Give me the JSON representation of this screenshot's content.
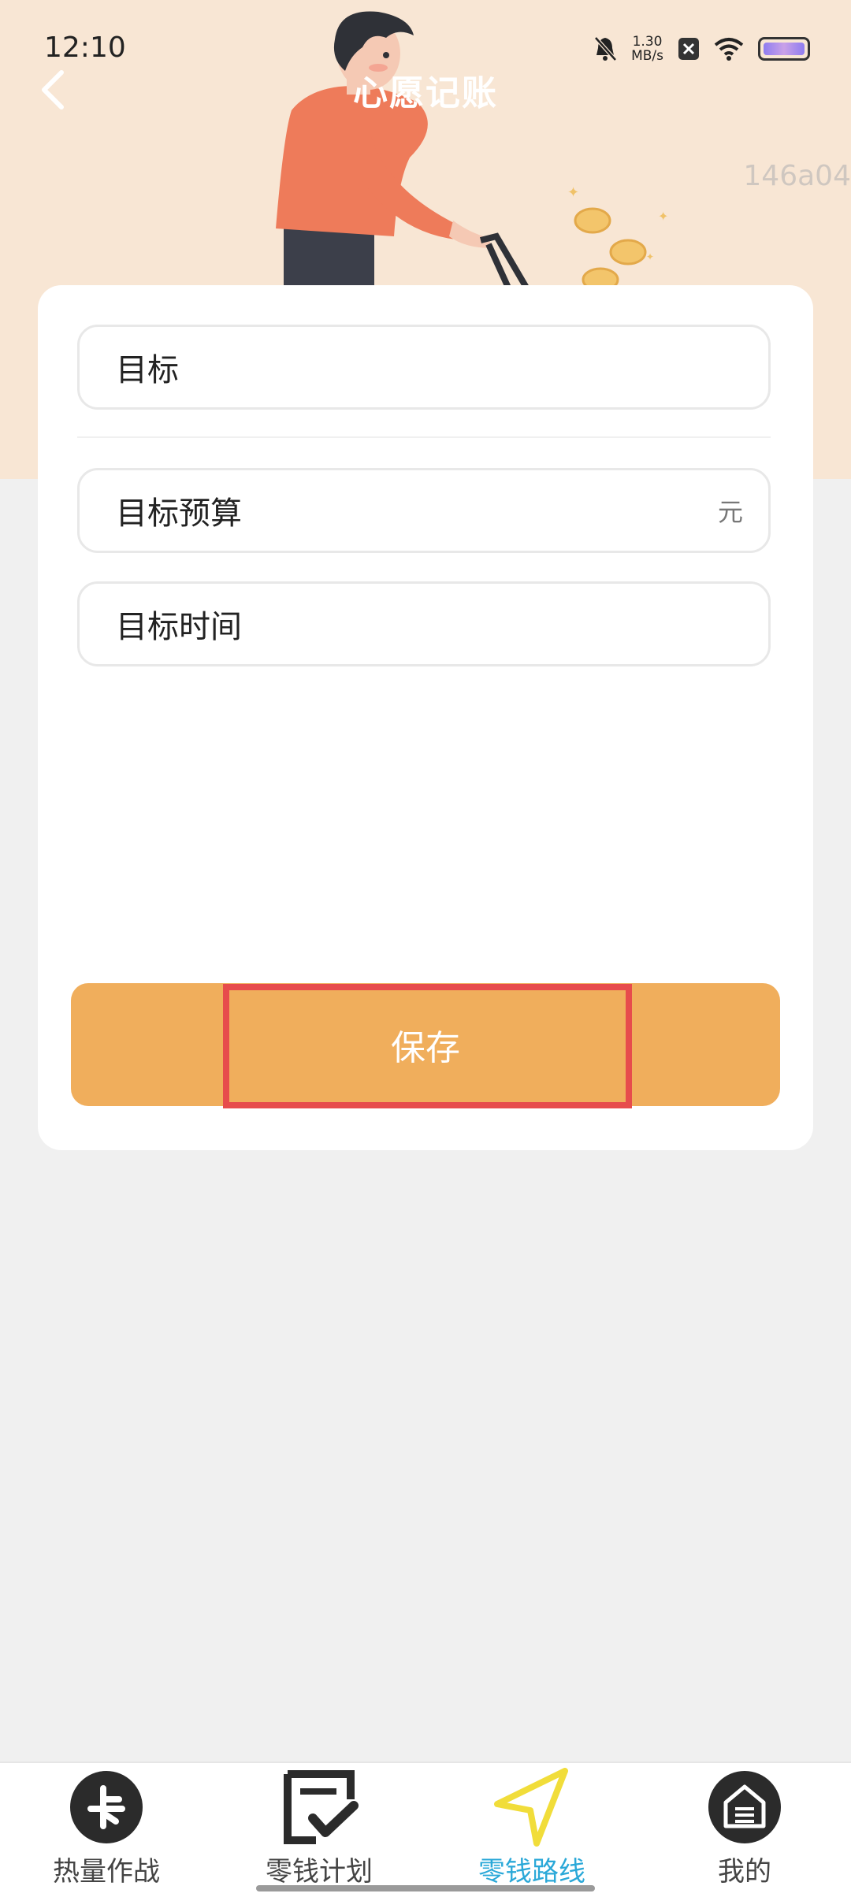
{
  "status_bar": {
    "time": "12:10",
    "net_speed_value": "1.30",
    "net_speed_unit": "MB/s",
    "icons": [
      "bell-off-icon",
      "close-box-icon",
      "wifi-icon",
      "battery-icon"
    ]
  },
  "header": {
    "title": "心愿记账",
    "watermark": "146a04"
  },
  "form": {
    "goal_label": "目标",
    "budget_label": "目标预算",
    "budget_unit": "元",
    "time_label": "目标时间",
    "save_label": "保存"
  },
  "bottom_nav": {
    "items": [
      {
        "label": "热量作战",
        "icon": "card-icon",
        "active": false
      },
      {
        "label": "零钱计划",
        "icon": "checklist-icon",
        "active": false
      },
      {
        "label": "零钱路线",
        "icon": "navigation-arrow-icon",
        "active": true
      },
      {
        "label": "我的",
        "icon": "home-icon",
        "active": false
      }
    ]
  },
  "colors": {
    "header_bg": "#f8e6d4",
    "accent": "#f0ae5c",
    "active_tab": "#2aa8d8",
    "highlight_border": "#e74c4c"
  }
}
